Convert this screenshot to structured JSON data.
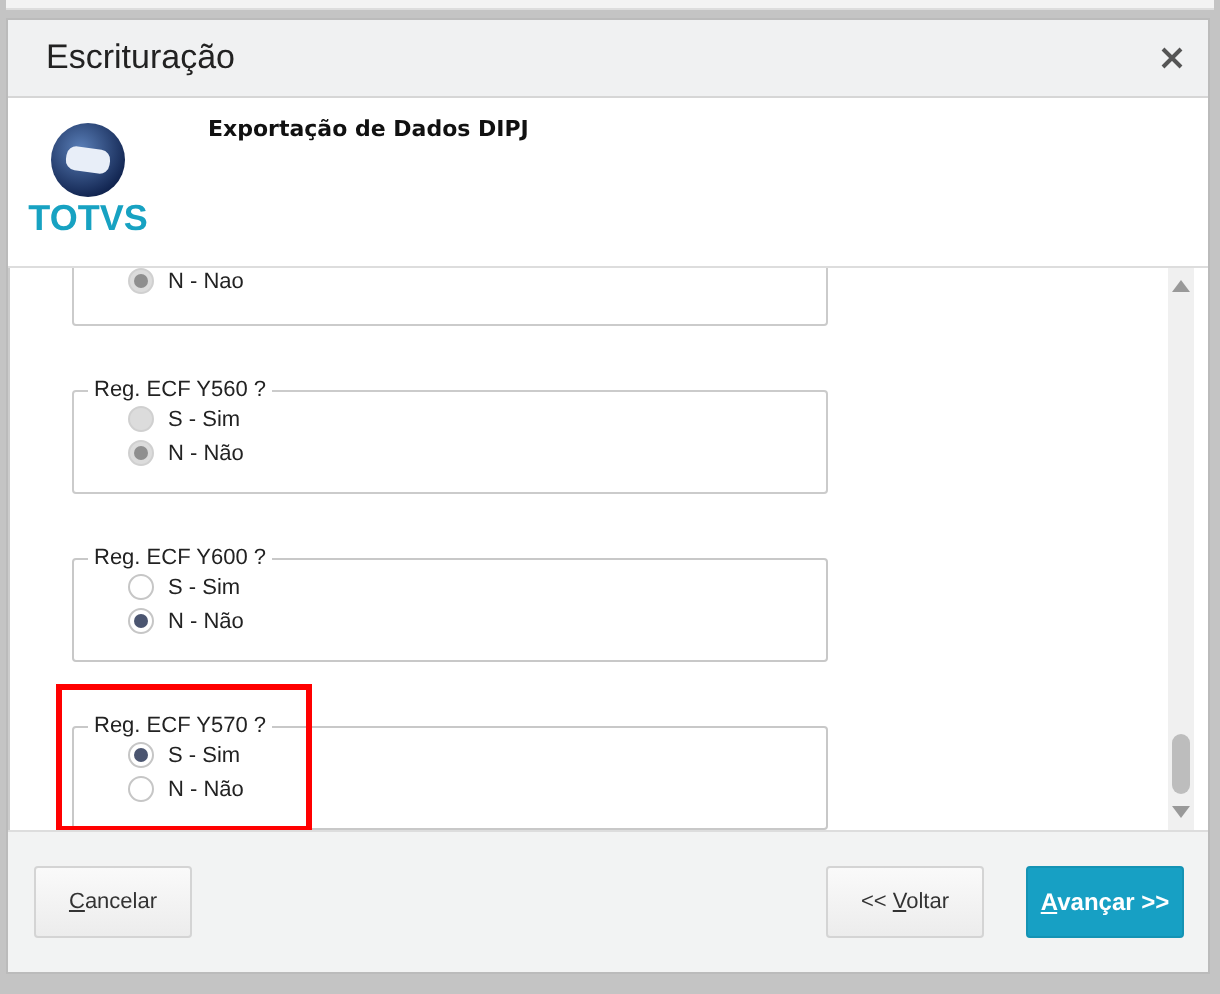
{
  "window": {
    "title": "Escrituração"
  },
  "header": {
    "logo_text": "TOTVS",
    "subtitle": "Exportação de Dados DIPJ"
  },
  "groups": [
    {
      "disabled": true,
      "highlight": false,
      "options": [
        {
          "label": "N - Nao",
          "selected": true
        }
      ]
    },
    {
      "label": "Reg. ECF Y560 ?",
      "disabled": true,
      "highlight": false,
      "options": [
        {
          "label": "S - Sim",
          "selected": false
        },
        {
          "label": "N - Não",
          "selected": true
        }
      ]
    },
    {
      "label": "Reg. ECF Y600 ?",
      "disabled": false,
      "highlight": false,
      "options": [
        {
          "label": "S - Sim",
          "selected": false
        },
        {
          "label": "N - Não",
          "selected": true
        }
      ]
    },
    {
      "label": "Reg. ECF Y570 ?",
      "disabled": false,
      "highlight": true,
      "options": [
        {
          "label": "S - Sim",
          "selected": true
        },
        {
          "label": "N - Não",
          "selected": false
        }
      ]
    }
  ],
  "buttons": [
    {
      "label": "Cancelar",
      "mnemonic": true,
      "kind": "secondary"
    },
    {
      "label": "<< Voltar",
      "mnemonic": true,
      "kind": "secondary"
    },
    {
      "label": "Avançar >>",
      "mnemonic": true,
      "kind": "primary"
    }
  ]
}
